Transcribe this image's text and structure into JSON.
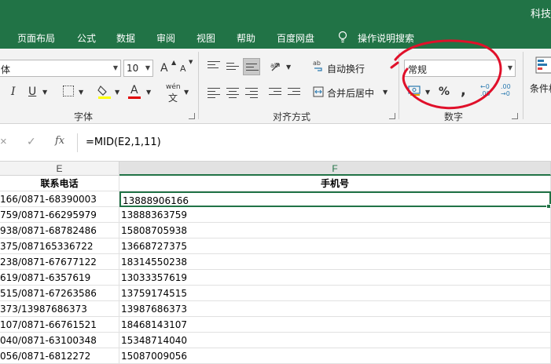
{
  "window": {
    "title": "科技"
  },
  "menu": {
    "items": [
      "页面布局",
      "公式",
      "数据",
      "审阅",
      "视图",
      "帮助",
      "百度网盘"
    ],
    "tell_me": "操作说明搜索"
  },
  "ribbon": {
    "font_name": "体",
    "font_size": "10",
    "grow_font": "A",
    "shrink_font": "A",
    "italic": "I",
    "underline": "U",
    "font_color_glyph": "A",
    "phonetic_glyph": "wén",
    "wrap_text": "自动换行",
    "merge_center": "合并后居中",
    "number_format": "常规",
    "percent": "%",
    "comma": ",",
    "conditional_format": "条件格",
    "groups": {
      "font": "字体",
      "alignment": "对齐方式",
      "number": "数字"
    }
  },
  "formula_bar": {
    "cancel": "×",
    "enter": "✓",
    "fx": "fx",
    "formula": "=MID(E2,1,11)"
  },
  "sheet": {
    "columns": [
      "E",
      "F"
    ],
    "selected_column": "F",
    "headers": {
      "E": "联系电话",
      "F": "手机号"
    },
    "rows": [
      {
        "E": "166/0871-68390003",
        "F": "13888906166"
      },
      {
        "E": "759/0871-66295979",
        "F": "13888363759"
      },
      {
        "E": "938/0871-68782486",
        "F": "15808705938"
      },
      {
        "E": "375/087165336722",
        "F": "13668727375"
      },
      {
        "E": "238/0871-67677122",
        "F": "18314550238"
      },
      {
        "E": "619/0871-6357619",
        "F": "13033357619"
      },
      {
        "E": "515/0871-67263586",
        "F": "13759174515"
      },
      {
        "E": "373/13987686373",
        "F": "13987686373"
      },
      {
        "E": "107/0871-66761521",
        "F": "18468143107"
      },
      {
        "E": "040/0871-63100348",
        "F": "15348714040"
      },
      {
        "E": "056/0871-6812272",
        "F": "15087009056"
      }
    ]
  },
  "colors": {
    "accent": "#217346",
    "annotation": "#e0102a"
  }
}
